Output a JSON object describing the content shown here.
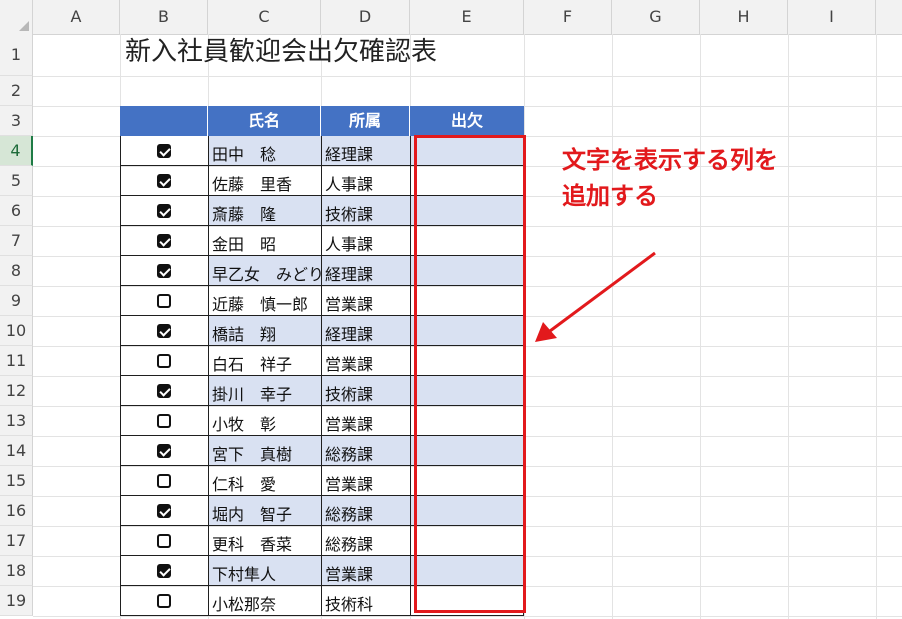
{
  "sheet": {
    "columns": [
      "A",
      "B",
      "C",
      "D",
      "E",
      "F",
      "G",
      "H",
      "I"
    ],
    "rows": [
      "1",
      "2",
      "3",
      "4",
      "5",
      "6",
      "7",
      "8",
      "9",
      "10",
      "11",
      "12",
      "13",
      "14",
      "15",
      "16",
      "17",
      "18",
      "19"
    ],
    "active_row": "4"
  },
  "title": "新入社員歓迎会出欠確認表",
  "table": {
    "headers": {
      "name": "氏名",
      "dept": "所属",
      "attend": "出欠"
    },
    "rows": [
      {
        "checked": true,
        "name": "田中　稔",
        "dept": "経理課"
      },
      {
        "checked": true,
        "name": "佐藤　里香",
        "dept": "人事課"
      },
      {
        "checked": true,
        "name": "斎藤　隆",
        "dept": "技術課"
      },
      {
        "checked": true,
        "name": "金田　昭",
        "dept": "人事課"
      },
      {
        "checked": true,
        "name": "早乙女　みどり",
        "dept": "経理課"
      },
      {
        "checked": false,
        "name": "近藤　慎一郎",
        "dept": "営業課"
      },
      {
        "checked": true,
        "name": "橋詰　翔",
        "dept": "経理課"
      },
      {
        "checked": false,
        "name": "白石　祥子",
        "dept": "営業課"
      },
      {
        "checked": true,
        "name": "掛川　幸子",
        "dept": "技術課"
      },
      {
        "checked": false,
        "name": "小牧　彰",
        "dept": "営業課"
      },
      {
        "checked": true,
        "name": "宮下　真樹",
        "dept": "総務課"
      },
      {
        "checked": false,
        "name": "仁科　愛",
        "dept": "営業課"
      },
      {
        "checked": true,
        "name": "堀内　智子",
        "dept": "総務課"
      },
      {
        "checked": false,
        "name": "更科　香菜",
        "dept": "総務課"
      },
      {
        "checked": true,
        "name": "下村隼人",
        "dept": "営業課"
      },
      {
        "checked": false,
        "name": "小松那奈",
        "dept": "技術科"
      }
    ]
  },
  "annotation": {
    "line1": "文字を表示する列を",
    "line2": "追加する",
    "color": "#e2191c"
  },
  "colors": {
    "header_bg": "#4472c4",
    "band": "#d9e1f2",
    "highlight": "#e2191c"
  }
}
